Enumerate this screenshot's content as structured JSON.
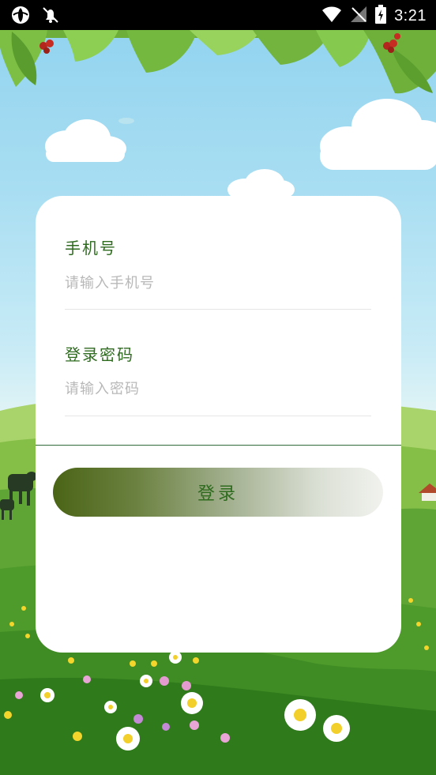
{
  "status_bar": {
    "time": "3:21"
  },
  "form": {
    "phone_label": "手机号",
    "phone_placeholder": "请输入手机号",
    "password_label": "登录密码",
    "password_placeholder": "请输入密码"
  },
  "login_button": {
    "label": "登录"
  },
  "colors": {
    "label_green": "#2e6b1f",
    "divider": "#2f6a3a",
    "sky": "#8fd2ef"
  },
  "icons": {
    "status_left": [
      "sync-icon",
      "notification-muted-icon"
    ],
    "status_right": [
      "wifi-icon",
      "no-signal-icon",
      "battery-charging-icon"
    ]
  }
}
